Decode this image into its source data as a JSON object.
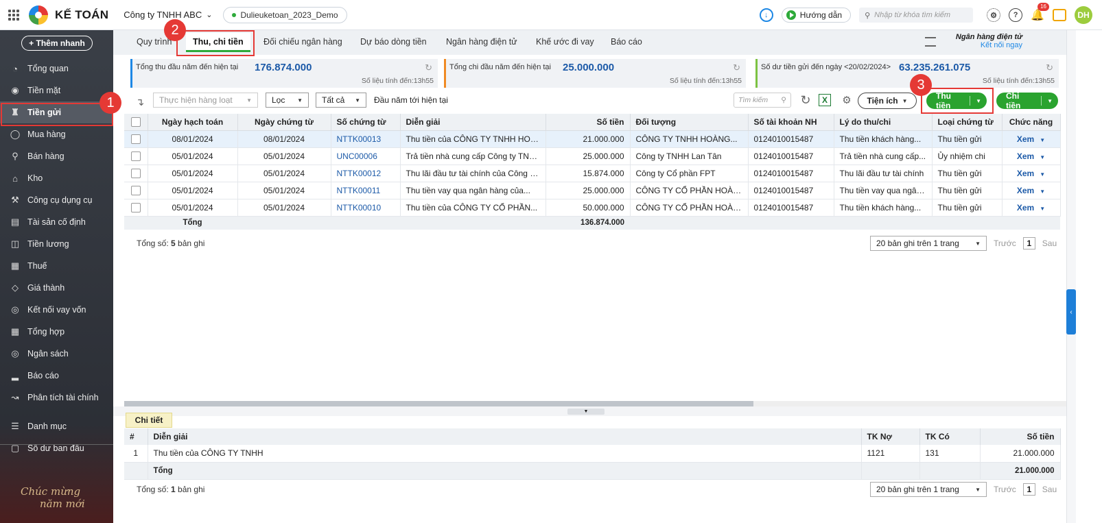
{
  "topbar": {
    "logo_text": "KẾ TOÁN",
    "company": "Công ty TNHH ABC",
    "database": "Dulieuketoan_2023_Demo",
    "guide_label": "Hướng dẫn",
    "search_placeholder": "Nhập từ khóa tìm kiếm",
    "notification_count": "16",
    "avatar_initials": "DH"
  },
  "sidebar": {
    "quick_add": "+ Thêm nhanh",
    "items": [
      {
        "label": "Tổng quan",
        "icon": "dashboard-icon"
      },
      {
        "label": "Tiền mặt",
        "icon": "money-bag-icon"
      },
      {
        "label": "Tiền gửi",
        "icon": "bank-icon"
      },
      {
        "label": "Mua hàng",
        "icon": "shopping-bag-icon"
      },
      {
        "label": "Bán hàng",
        "icon": "cart-icon"
      },
      {
        "label": "Kho",
        "icon": "warehouse-icon"
      },
      {
        "label": "Công cụ dụng cụ",
        "icon": "tools-icon"
      },
      {
        "label": "Tài sản cố định",
        "icon": "car-icon"
      },
      {
        "label": "Tiền lương",
        "icon": "salary-icon"
      },
      {
        "label": "Thuế",
        "icon": "tax-icon"
      },
      {
        "label": "Giá thành",
        "icon": "price-tag-icon"
      },
      {
        "label": "Kết nối vay vốn",
        "icon": "loan-icon"
      },
      {
        "label": "Tổng hợp",
        "icon": "summary-icon"
      },
      {
        "label": "Ngân sách",
        "icon": "budget-icon"
      },
      {
        "label": "Báo cáo",
        "icon": "bar-chart-icon"
      },
      {
        "label": "Phân tích tài chính",
        "icon": "line-chart-icon"
      },
      {
        "label": "Danh mục",
        "icon": "list-icon"
      },
      {
        "label": "Số dư ban đầu",
        "icon": "opening-balance-icon"
      }
    ],
    "greeting_line1": "Chúc mừng",
    "greeting_line2": "năm mới"
  },
  "annotations": [
    "1",
    "2",
    "3"
  ],
  "tabs": [
    "Quy trình",
    "Thu, chi tiền",
    "Đối chiếu ngân hàng",
    "Dự báo dòng tiền",
    "Ngân hàng điện tử",
    "Khế ước đi vay",
    "Báo cáo"
  ],
  "bank_link": {
    "title": "Ngân hàng điện tử",
    "link": "Kết nối ngay"
  },
  "cards": [
    {
      "label": "Tổng thu đầu năm đến hiện tại",
      "value": "176.874.000",
      "note": "Số liệu tính đến:13h55",
      "color": "#1e88e5"
    },
    {
      "label": "Tổng chi đầu năm đến hiện tại",
      "value": "25.000.000",
      "note": "Số liệu tính đến:13h55",
      "color": "#f08a24"
    },
    {
      "label": "Số dư tiền gửi đến ngày <20/02/2024>",
      "value": "63.235.261.075",
      "note": "Số liệu tính đến:13h55",
      "color": "#7cc242"
    }
  ],
  "toolbar": {
    "batch_placeholder": "Thực hiện hàng loạt",
    "filter_label": "Lọc",
    "all_label": "Tất cả",
    "period_text": "Đầu năm tới hiện tại",
    "search_placeholder": "Tìm kiếm",
    "utilities_label": "Tiện ích",
    "receive_label": "Thu tiền",
    "pay_label": "Chi tiền"
  },
  "table": {
    "columns": [
      "Ngày hạch toán",
      "Ngày chứng từ",
      "Số chứng từ",
      "Diễn giải",
      "Số tiền",
      "Đối tượng",
      "Số tài khoản NH",
      "Lý do thu/chi",
      "Loại chứng từ",
      "Chức năng"
    ],
    "rows": [
      [
        "08/01/2024",
        "08/01/2024",
        "NTTK00013",
        "Thu tiền của CÔNG TY TNHH HOÀN...",
        "21.000.000",
        "CÔNG TY TNHH HOÀNG...",
        "0124010015487",
        "Thu tiền khách hàng...",
        "Thu tiền gửi",
        "Xem"
      ],
      [
        "05/01/2024",
        "05/01/2024",
        "UNC00006",
        "Trả tiền nhà cung cấp Công ty TNH...",
        "25.000.000",
        "Công ty TNHH Lan Tân",
        "0124010015487",
        "Trả tiền nhà cung cấp...",
        "Ủy nhiệm chi",
        "Xem"
      ],
      [
        "05/01/2024",
        "05/01/2024",
        "NTTK00012",
        "Thu lãi đầu tư tài chính của Công ty...",
        "15.874.000",
        "Công ty Cổ phần FPT",
        "0124010015487",
        "Thu lãi đầu tư tài chính",
        "Thu tiền gửi",
        "Xem"
      ],
      [
        "05/01/2024",
        "05/01/2024",
        "NTTK00011",
        "Thu tiền vay qua ngân hàng của...",
        "25.000.000",
        "CÔNG TY CỔ PHẦN HOÀNG...",
        "0124010015487",
        "Thu tiền vay qua ngân...",
        "Thu tiền gửi",
        "Xem"
      ],
      [
        "05/01/2024",
        "05/01/2024",
        "NTTK00010",
        "Thu tiền của CÔNG TY CỔ PHẦN...",
        "50.000.000",
        "CÔNG TY CỔ PHẦN HOÀNG...",
        "0124010015487",
        "Thu tiền khách hàng...",
        "Thu tiền gửi",
        "Xem"
      ]
    ],
    "total_label": "Tổng",
    "total_value": "136.874.000",
    "count_prefix": "Tổng số: ",
    "count": "5",
    "count_suffix": " bản ghi"
  },
  "pager": {
    "size_label": "20 bản ghi trên 1 trang",
    "prev": "Trước",
    "page": "1",
    "next": "Sau"
  },
  "detail": {
    "tab_label": "Chi tiết",
    "columns": [
      "#",
      "Diễn giải",
      "TK Nợ",
      "TK Có",
      "Số tiền"
    ],
    "rows": [
      [
        "1",
        "Thu tiền của CÔNG TY TNHH",
        "1121",
        "131",
        "21.000.000"
      ]
    ],
    "total_label": "Tổng",
    "total_value": "21.000.000",
    "count_prefix": "Tổng số: ",
    "count": "1",
    "count_suffix": " bản ghi"
  }
}
